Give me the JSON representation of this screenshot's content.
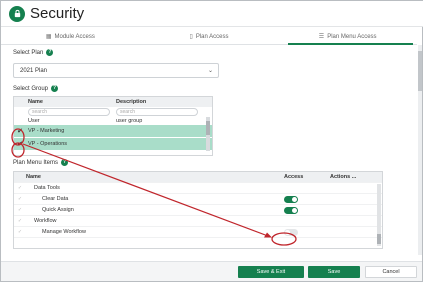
{
  "header": {
    "title": "Security",
    "icon": "lock-icon"
  },
  "tabs": [
    {
      "label": "Module Access",
      "icon": "grid-icon",
      "active": false
    },
    {
      "label": "Plan Access",
      "icon": "file-icon",
      "active": false
    },
    {
      "label": "Plan Menu Access",
      "icon": "list-icon",
      "active": true
    }
  ],
  "select_plan": {
    "label": "Select Plan",
    "value": "2021 Plan"
  },
  "select_group": {
    "label": "Select Group",
    "columns": [
      "Name",
      "Description"
    ],
    "search_placeholders": [
      "search",
      "search"
    ],
    "rows": [
      {
        "name": "User",
        "description": "user group",
        "selected": false
      },
      {
        "name": "VP - Marketing",
        "description": "",
        "selected": true
      },
      {
        "name": "VP - Operations",
        "description": "",
        "selected": true
      }
    ]
  },
  "plan_menu": {
    "label": "Plan Menu Items",
    "columns": [
      "Name",
      "Access",
      "Actions ..."
    ],
    "rows": [
      {
        "name": "Data Tools",
        "indent": 1,
        "access": null
      },
      {
        "name": "Clear Data",
        "indent": 2,
        "access": true
      },
      {
        "name": "Quick Assign",
        "indent": 2,
        "access": true
      },
      {
        "name": "Workflow",
        "indent": 1,
        "access": null
      },
      {
        "name": "Manage Workflow",
        "indent": 2,
        "access": false
      }
    ]
  },
  "footer": {
    "save_exit": "Save & Exit",
    "save": "Save",
    "cancel": "Cancel"
  },
  "colors": {
    "accent": "#15804f",
    "selected_row": "#a9ddc9",
    "annotation": "#c0262c"
  }
}
